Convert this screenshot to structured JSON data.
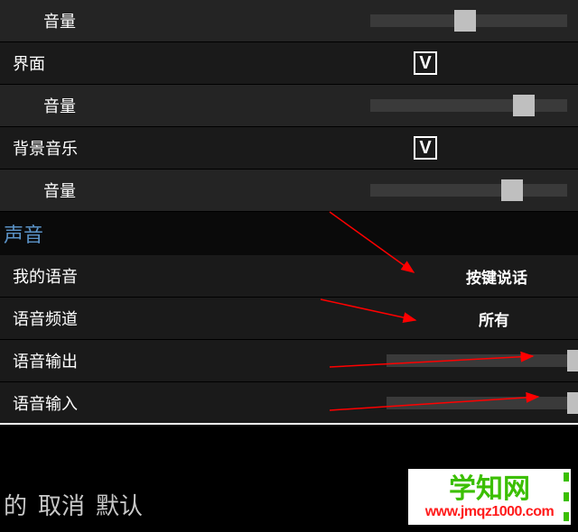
{
  "rows": {
    "vol0": {
      "label": "音量",
      "slider": 48
    },
    "interface": {
      "label": "界面",
      "checked": true
    },
    "vol1": {
      "label": "音量",
      "slider": 78
    },
    "bgm": {
      "label": "背景音乐",
      "checked": true
    },
    "vol2": {
      "label": "音量",
      "slider": 72
    }
  },
  "section": {
    "voice_header": "声音"
  },
  "voice": {
    "my_voice": {
      "label": "我的语音",
      "value": "按键说话"
    },
    "channel": {
      "label": "语音频道",
      "value": "所有"
    },
    "output": {
      "label": "语音输出",
      "slider": 100
    },
    "input": {
      "label": "语音输入",
      "slider": 100
    }
  },
  "footer": {
    "partial": "的",
    "cancel": "取消",
    "default": "默认"
  },
  "watermark": {
    "title": "学知网",
    "url": "www.jmqz1000.com"
  }
}
